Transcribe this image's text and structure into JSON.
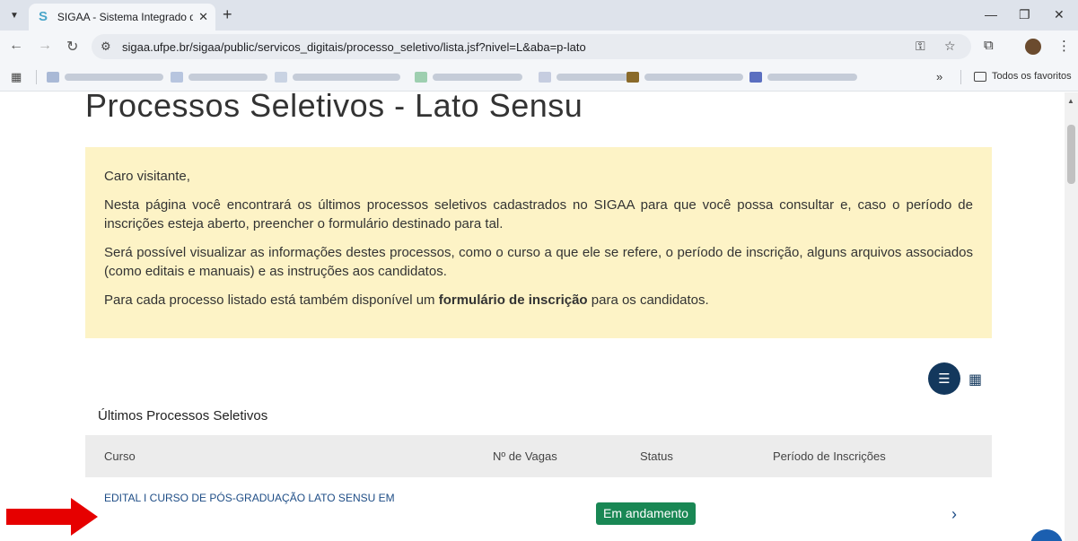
{
  "browser": {
    "tab_title": "SIGAA - Sistema Integrado de Gestão",
    "url": "sigaa.ufpe.br/sigaa/public/servicos_digitais/processo_seletivo/lista.jsf?nivel=L&aba=p-lato",
    "bookmarks_all_label": "Todos os favoritos"
  },
  "page": {
    "title": "Processos Seletivos - Lato Sensu",
    "notice": {
      "greeting": "Caro visitante,",
      "paragraph1": "Nesta página você encontrará os últimos processos seletivos cadastrados no SIGAA para que você possa consultar e, caso o período de inscrições esteja aberto, preencher o formulário destinado para tal.",
      "paragraph2": "Será possível visualizar as informações destes processos, como o curso a que ele se refere, o período de inscrição, alguns arquivos associados (como editais e manuais) e as instruções aos candidatos.",
      "paragraph3_prefix": "Para cada processo listado está também disponível um",
      "paragraph3_bold": "formulário de inscrição",
      "paragraph3_suffix": "para os candidatos."
    },
    "section_title": "Últimos Processos Seletivos",
    "table": {
      "headers": [
        "Curso",
        "Nº de Vagas",
        "Status",
        "Período de Inscrições"
      ],
      "rows": [
        {
          "curso": "EDITAL I  CURSO DE PÓS-GRADUAÇÃO LATO SENSU EM",
          "status": "Em andamento"
        }
      ]
    }
  },
  "colors": {
    "notice_bg": "#fdf3c6",
    "primary": "#13385d",
    "status_green": "#198754",
    "link": "#1e4d86",
    "annotation_arrow": "#e60000"
  }
}
